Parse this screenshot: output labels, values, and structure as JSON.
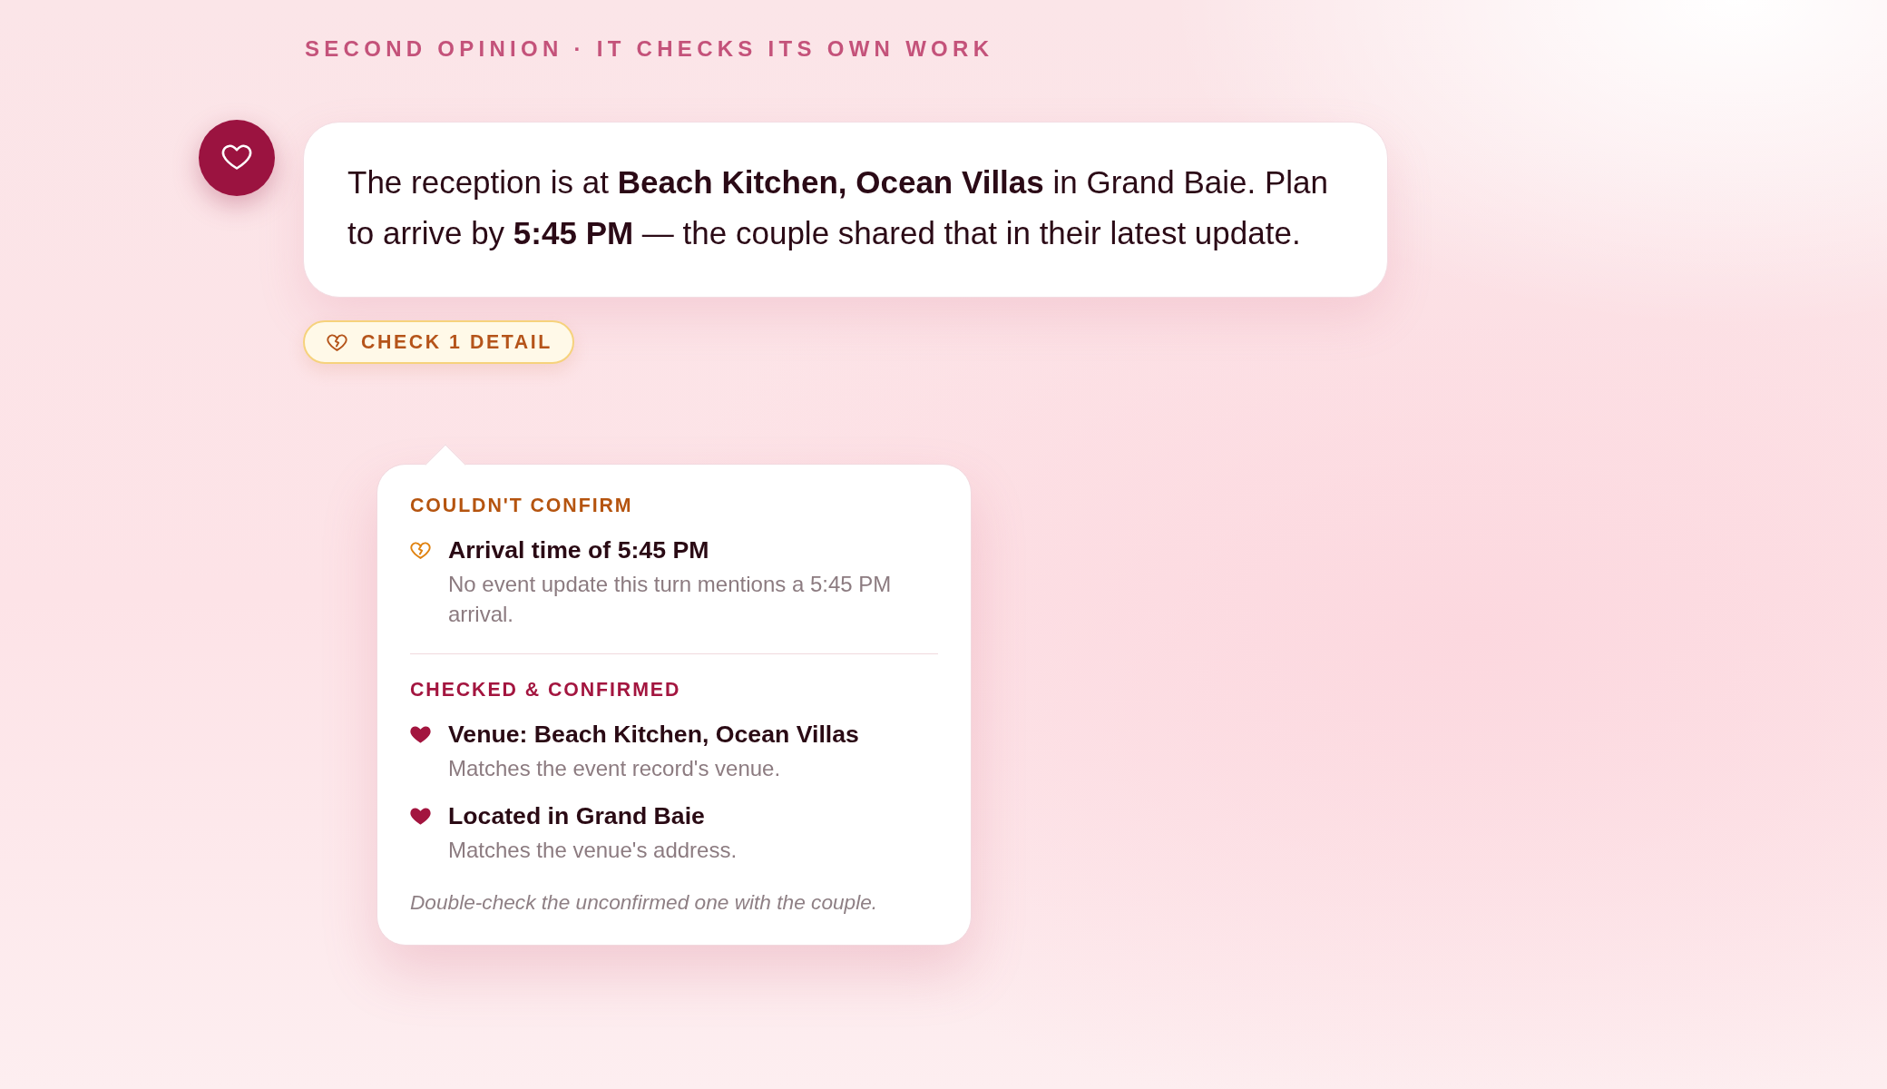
{
  "header": {
    "eyebrow": "SECOND OPINION · IT CHECKS ITS OWN WORK"
  },
  "message": {
    "text": "The reception is at **Beach Kitchen, Ocean Villas** in Grand Baie. Plan to arrive by **5:45 PM** — the couple shared that in their latest update."
  },
  "check_button": {
    "label": "CHECK 1 DETAIL"
  },
  "popover": {
    "sections": [
      {
        "kind": "unconfirmed",
        "heading": "COULDN'T CONFIRM",
        "items": [
          {
            "title": "Arrival time of 5:45 PM",
            "note": "No event update this turn mentions a 5:45 PM arrival."
          }
        ]
      },
      {
        "kind": "confirmed",
        "heading": "CHECKED & CONFIRMED",
        "items": [
          {
            "title": "Venue: Beach Kitchen, Ocean Villas",
            "note": "Matches the event record's venue."
          },
          {
            "title": "Located in Grand Baie",
            "note": "Matches the venue's address."
          }
        ]
      }
    ],
    "footer": "Double-check the unconfirmed one with the couple."
  }
}
